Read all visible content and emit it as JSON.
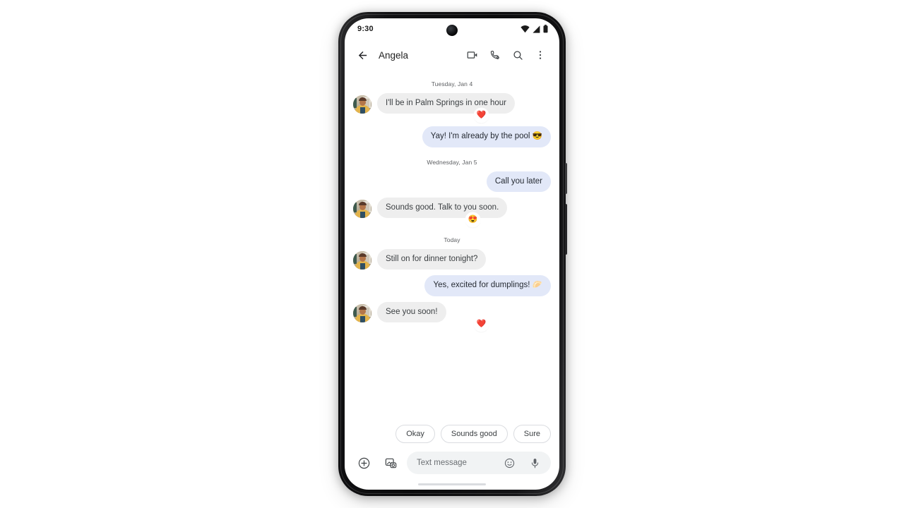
{
  "device": {
    "frame": "android-phone",
    "home_indicator": true
  },
  "status_bar": {
    "time": "9:30",
    "icons": [
      "wifi-icon",
      "cellular-signal-icon",
      "battery-icon"
    ]
  },
  "app_bar": {
    "back_icon": "arrow-back-icon",
    "contact_name": "Angela",
    "actions": [
      {
        "name": "video-call-button",
        "icon": "video-camera-icon"
      },
      {
        "name": "voice-call-button",
        "icon": "phone-icon"
      },
      {
        "name": "search-button",
        "icon": "search-icon"
      },
      {
        "name": "more-options-button",
        "icon": "overflow-menu-icon"
      }
    ]
  },
  "thread": {
    "groups": [
      {
        "date_label": "Tuesday, Jan 4",
        "messages": [
          {
            "side": "in",
            "text": "I'll be in Palm Springs in one hour",
            "avatar": true,
            "reaction": "❤️",
            "reaction_side": "in"
          },
          {
            "side": "out",
            "text": "Yay! I'm already by the pool 😎",
            "avatar": false,
            "reaction": null
          }
        ]
      },
      {
        "date_label": "Wednesday, Jan 5",
        "messages": [
          {
            "side": "out",
            "text": "Call you later",
            "avatar": false,
            "reaction": null
          },
          {
            "side": "in",
            "text": "Sounds good. Talk to you soon.",
            "avatar": true,
            "reaction": "😍",
            "reaction_side": "in"
          }
        ]
      },
      {
        "date_label": "Today",
        "messages": [
          {
            "side": "in",
            "text": "Still on for dinner tonight?",
            "avatar": true,
            "reaction": null
          },
          {
            "side": "out",
            "text": "Yes, excited for dumplings! 🥟",
            "avatar": false,
            "reaction": null
          },
          {
            "side": "in",
            "text": "See you soon!",
            "avatar": true,
            "reaction": "❤️",
            "reaction_side": "in"
          }
        ]
      }
    ]
  },
  "suggestions": {
    "chips": [
      "Okay",
      "Sounds good",
      "Sure"
    ]
  },
  "compose": {
    "add_icon": "plus-circle-icon",
    "gallery_icon": "image-camera-icon",
    "placeholder": "Text message",
    "value": "",
    "emoji_icon": "emoji-smiley-icon",
    "mic_icon": "microphone-icon"
  },
  "colors": {
    "incoming_bubble": "#eeeeee",
    "outgoing_bubble": "#e2e8f8",
    "incoming_text": "#3c4043",
    "outgoing_text": "#262b33",
    "field_background": "#f1f3f4",
    "chip_border": "#dadce0",
    "reaction_heart": "#ea3323"
  }
}
